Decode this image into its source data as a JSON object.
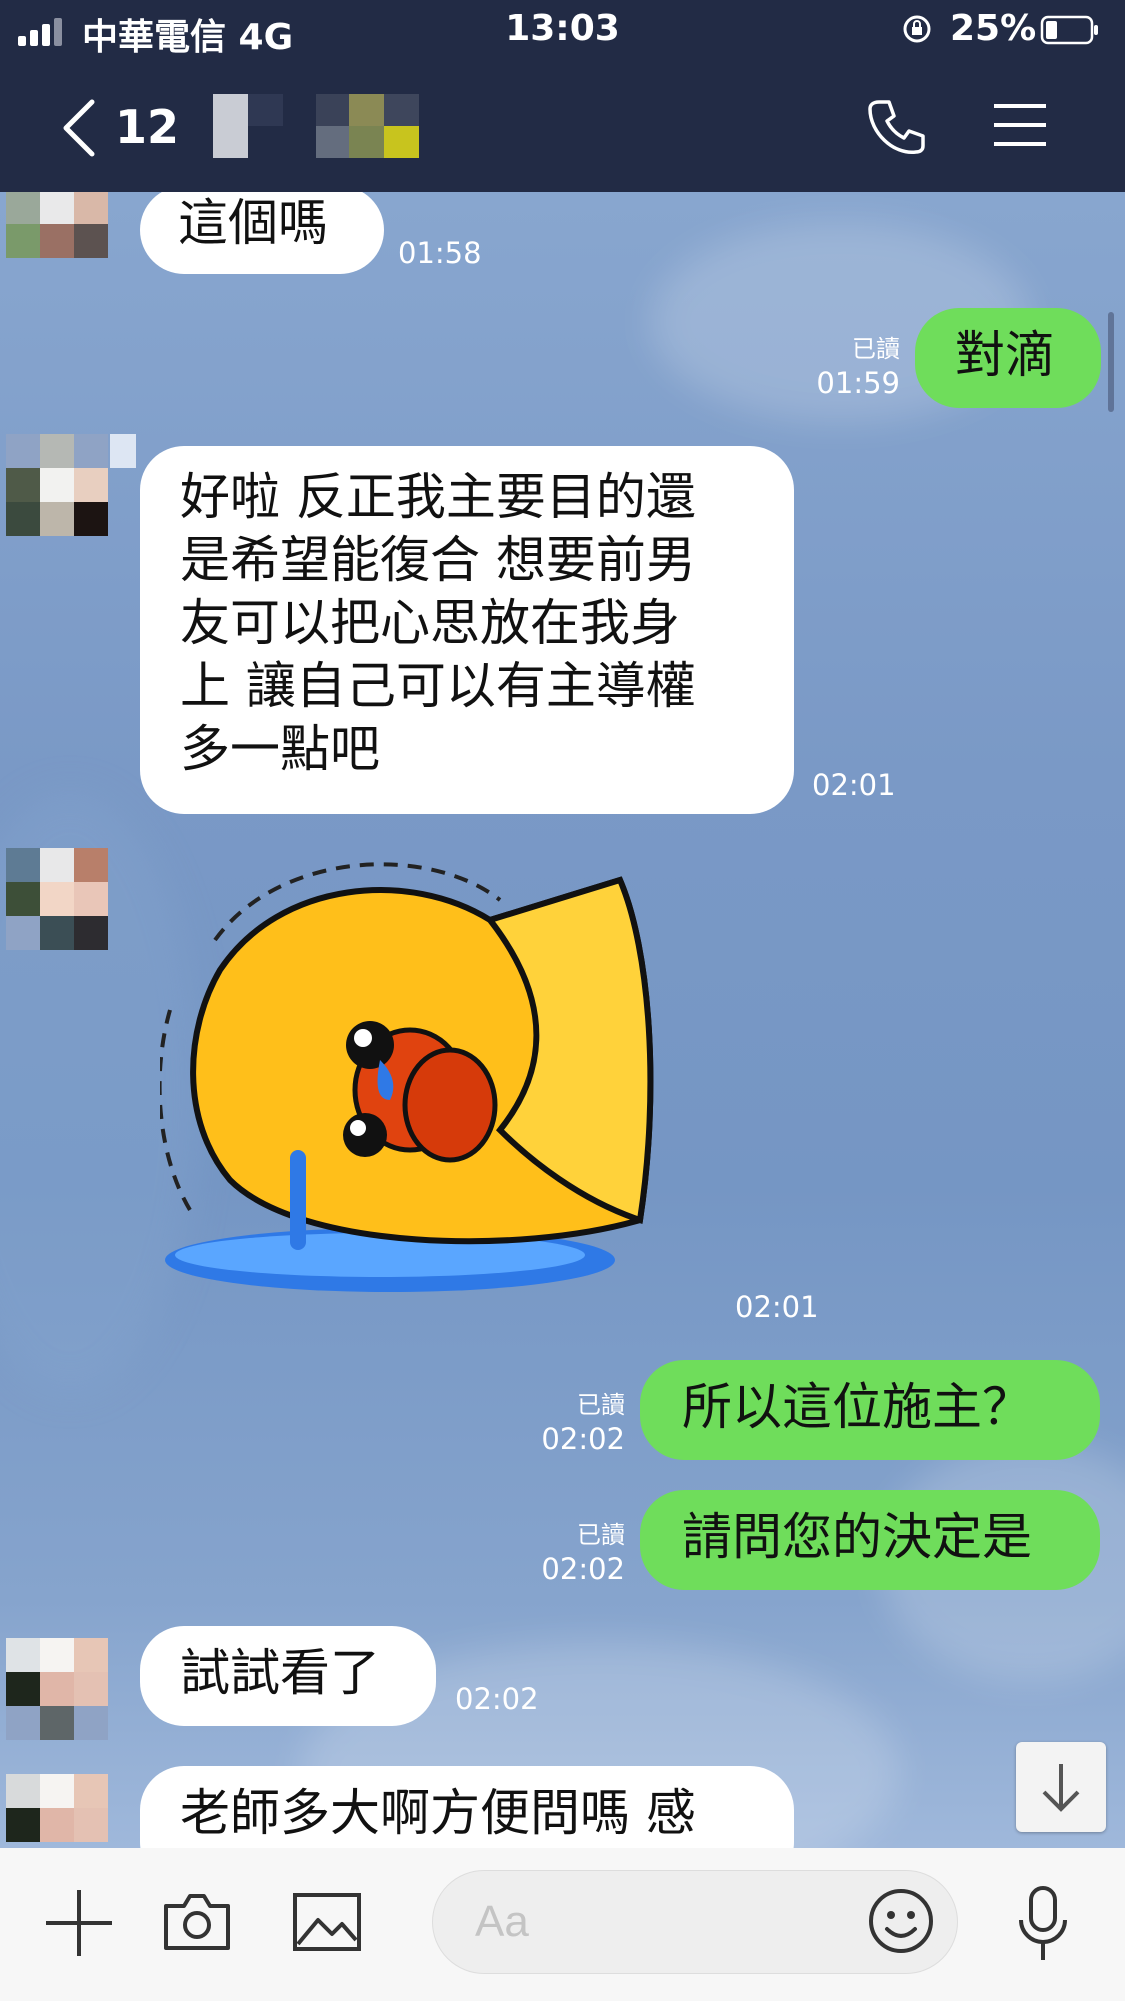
{
  "status_bar": {
    "carrier": "中華電信 4G",
    "time": "13:03",
    "battery": "25%"
  },
  "header": {
    "back_count": "12",
    "icons": [
      "chevron-left-icon",
      "phone-icon",
      "menu-icon"
    ]
  },
  "messages": [
    {
      "side": "in",
      "text": "這個嗎",
      "time": "01:58"
    },
    {
      "side": "out",
      "text": "對滴",
      "time": "01:59",
      "read": "已讀"
    },
    {
      "side": "in",
      "lines": [
        "好啦 反正我主要目的還",
        "是希望能復合 想要前男",
        "友可以把心思放在我身",
        "上  讓自己可以有主導權",
        "多一點吧"
      ],
      "time": "02:01"
    },
    {
      "side": "in",
      "type": "sticker",
      "time": "02:01"
    },
    {
      "side": "out",
      "text": "所以這位施主？",
      "time": "02:02",
      "read": "已讀"
    },
    {
      "side": "out",
      "text": "請問您的決定是",
      "time": "02:02",
      "read": "已讀"
    },
    {
      "side": "in",
      "text": "試試看了",
      "time": "02:02"
    },
    {
      "side": "in",
      "text": "老師多大啊方便問嗎  感",
      "time": ""
    }
  ],
  "input_bar": {
    "placeholder": "Aa",
    "icons": [
      "plus-icon",
      "camera-icon",
      "image-icon",
      "emoji-icon",
      "microphone-icon"
    ]
  },
  "colors": {
    "header_bg": "#222b45",
    "chat_bg": "#7d9cc9",
    "outgoing_bubble": "#6fdd5b",
    "incoming_bubble": "#ffffff"
  }
}
